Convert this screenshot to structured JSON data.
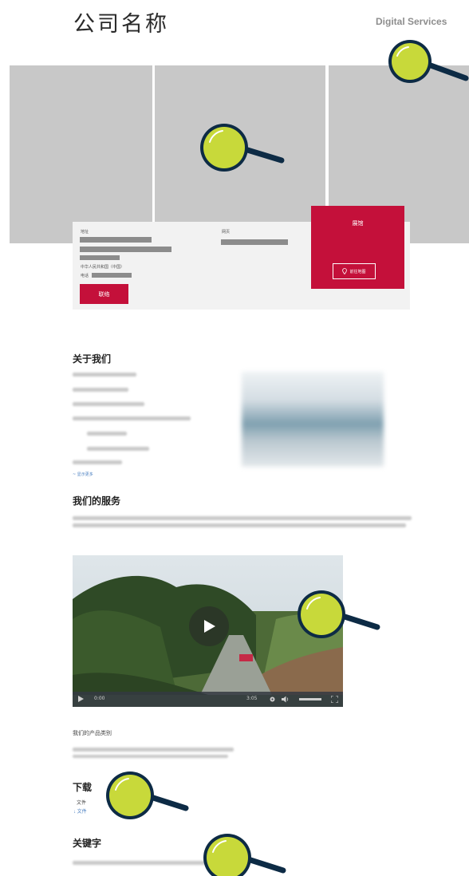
{
  "header": {
    "company_name": "公司名称",
    "digital_services": "Digital Services"
  },
  "info_card": {
    "address_label": "地址",
    "website_label": "网页",
    "country": "中华人民共和国（中国）",
    "phone_label": "电话",
    "contact_button": "联络",
    "showroom_title": "展馆",
    "map_button": "前往地图"
  },
  "about": {
    "title": "关于我们",
    "more_link": "~ 显示更多"
  },
  "services": {
    "title": "我们的服务"
  },
  "video": {
    "current_time": "0:00",
    "duration": "3:05"
  },
  "products": {
    "label": "我们的产品类别"
  },
  "downloads": {
    "title": "下载",
    "file_label": "文件",
    "file_link": "↓ 文件"
  },
  "keywords": {
    "title": "关键字"
  },
  "colors": {
    "accent_red": "#c4103a",
    "placeholder_gray": "#c8c8c8",
    "magnifier_fill": "#c8d93a",
    "magnifier_outline": "#0d2b45"
  },
  "icons": [
    "magnifier-icon",
    "map-pin-icon",
    "play-icon",
    "settings-icon",
    "volume-icon",
    "fullscreen-icon"
  ]
}
